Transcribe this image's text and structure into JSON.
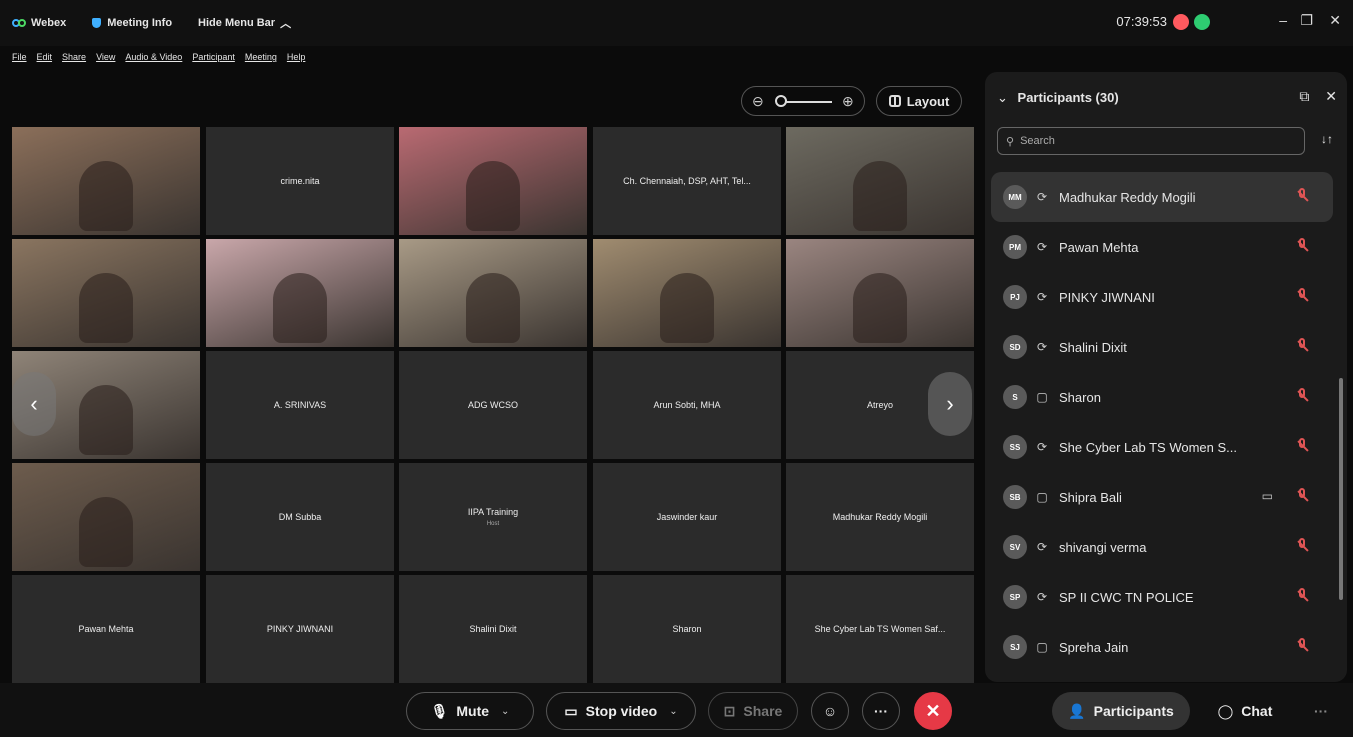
{
  "titlebar": {
    "app_name": "Webex",
    "meeting_info": "Meeting Info",
    "hide_menu": "Hide Menu Bar",
    "hide_menu_chevron": "︿",
    "clock": "07:39:53",
    "minimize": "–",
    "restore": "❐",
    "close": "✕"
  },
  "menu": [
    "File",
    "Edit",
    "Share",
    "View",
    "Audio & Video",
    "Participant",
    "Meeting",
    "Help"
  ],
  "stage": {
    "zoom_minus": "⊖",
    "zoom_plus": "⊕",
    "layout_label": "Layout",
    "prev_arrow": "‹",
    "next_arrow": "›"
  },
  "tiles": [
    {
      "name": "",
      "video": true,
      "bg": "#8b6f5a"
    },
    {
      "name": "crime.nita",
      "video": false
    },
    {
      "name": "",
      "video": true,
      "bg": "#b96a72"
    },
    {
      "name": "Ch. Chennaiah, DSP, AHT, Tel...",
      "video": false
    },
    {
      "name": "",
      "video": true,
      "bg": "#6d6a60"
    },
    {
      "name": "",
      "video": true,
      "bg": "#8a7560"
    },
    {
      "name": "",
      "video": true,
      "bg": "#c9a7aa"
    },
    {
      "name": "",
      "video": true,
      "bg": "#a89a86"
    },
    {
      "name": "",
      "video": true,
      "bg": "#a08c70"
    },
    {
      "name": "",
      "video": true,
      "bg": "#9a8580"
    },
    {
      "name": "",
      "video": true,
      "bg": "#8f8478"
    },
    {
      "name": "A. SRINIVAS",
      "video": false
    },
    {
      "name": "ADG WCSO",
      "video": false
    },
    {
      "name": "Arun Sobti, MHA",
      "video": false
    },
    {
      "name": "Atreyo",
      "video": false
    },
    {
      "name": "",
      "video": true,
      "bg": "#6d5c4d"
    },
    {
      "name": "DM Subba",
      "video": false
    },
    {
      "name": "IIPA Training",
      "host": "Host",
      "video": false
    },
    {
      "name": "Jaswinder kaur",
      "video": false
    },
    {
      "name": "Madhukar Reddy Mogili",
      "video": false
    },
    {
      "name": "Pawan Mehta",
      "video": false
    },
    {
      "name": "PINKY JIWNANI",
      "video": false
    },
    {
      "name": "Shalini Dixit",
      "video": false
    },
    {
      "name": "Sharon",
      "video": false
    },
    {
      "name": "She Cyber Lab TS Women Saf...",
      "video": false
    }
  ],
  "participants_panel": {
    "title": "Participants (30)",
    "popout": "⧉",
    "close": "✕",
    "collapse_chevron": "⌄",
    "search_placeholder": "Search",
    "sort": "↓↑",
    "items": [
      {
        "initials": "MM",
        "name": "Madhukar Reddy Mogili",
        "device": "⟳",
        "cam": ""
      },
      {
        "initials": "PM",
        "name": "Pawan Mehta",
        "device": "⟳",
        "cam": ""
      },
      {
        "initials": "PJ",
        "name": "PINKY JIWNANI",
        "device": "⟳",
        "cam": ""
      },
      {
        "initials": "SD",
        "name": "Shalini Dixit",
        "device": "⟳",
        "cam": ""
      },
      {
        "initials": "S",
        "name": "Sharon",
        "device": "▢",
        "cam": ""
      },
      {
        "initials": "SS",
        "name": "She Cyber Lab TS Women S...",
        "device": "⟳",
        "cam": ""
      },
      {
        "initials": "SB",
        "name": "Shipra Bali",
        "device": "▢",
        "cam": "▭"
      },
      {
        "initials": "SV",
        "name": "shivangi verma",
        "device": "⟳",
        "cam": ""
      },
      {
        "initials": "SP",
        "name": "SP II CWC TN POLICE",
        "device": "⟳",
        "cam": ""
      },
      {
        "initials": "SJ",
        "name": "Spreha Jain",
        "device": "▢",
        "cam": ""
      }
    ]
  },
  "controls": {
    "mute": "Mute",
    "stop_video": "Stop video",
    "share": "Share",
    "reactions": "☺",
    "more": "···",
    "leave": "✕",
    "participants": "Participants",
    "chat": "Chat",
    "overflow": "···",
    "chevron": "⌄"
  }
}
